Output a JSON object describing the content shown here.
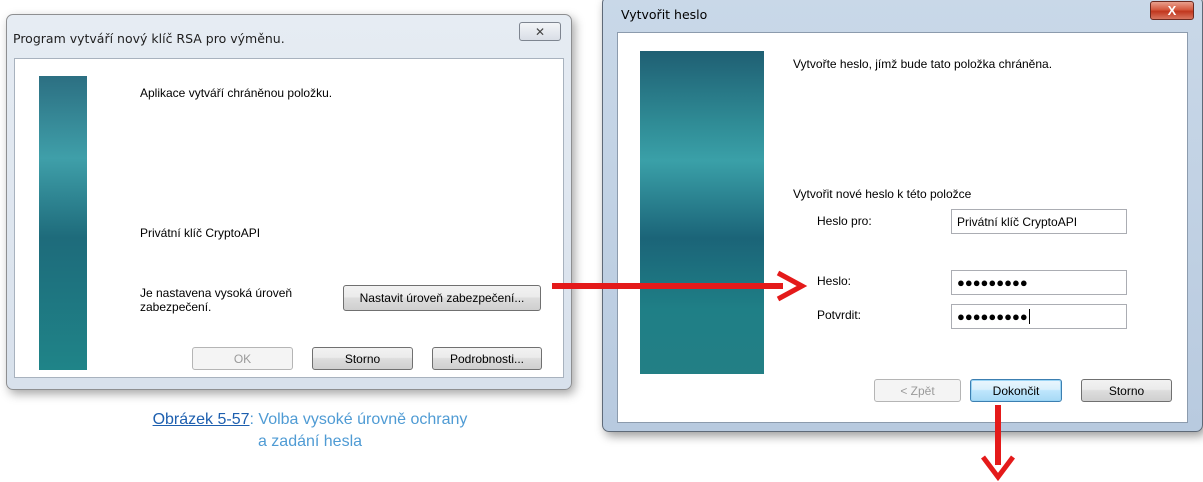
{
  "left_dialog": {
    "title": "Program vytváří nový klíč RSA pro výměnu.",
    "close_glyph": "✕",
    "heading": "Aplikace vytváří chráněnou položku.",
    "item_name": "Privátní klíč CryptoAPI",
    "security_text_line1": "Je nastavena vysoká úroveň",
    "security_text_line2": "zabezpečení.",
    "set_security_button": "Nastavit úroveň zabezpečení...",
    "ok_button": "OK",
    "cancel_button": "Storno",
    "details_button": "Podrobnosti..."
  },
  "caption": {
    "link": "Obrázek 5-57",
    "text_line1": ": Volba vysoké úrovně ochrany",
    "text_line2": "a zadání hesla"
  },
  "right_dialog": {
    "title": "Vytvořit heslo",
    "close_glyph": "X",
    "intro": "Vytvořte heslo, jímž bude tato položka chráněna.",
    "section_label": "Vytvořit nové heslo k této položce",
    "password_for_label": "Heslo pro:",
    "password_for_value": "Privátní klíč CryptoAPI",
    "password_label": "Heslo:",
    "password_value": "●●●●●●●●●",
    "confirm_label": "Potvrdit:",
    "confirm_value": "●●●●●●●●●",
    "back_button": "< Zpět",
    "finish_button": "Dokončit",
    "cancel_button": "Storno"
  },
  "colors": {
    "arrow": "#e41a1a",
    "caption_text": "#4f9bd4",
    "caption_link": "#1d5faf"
  }
}
